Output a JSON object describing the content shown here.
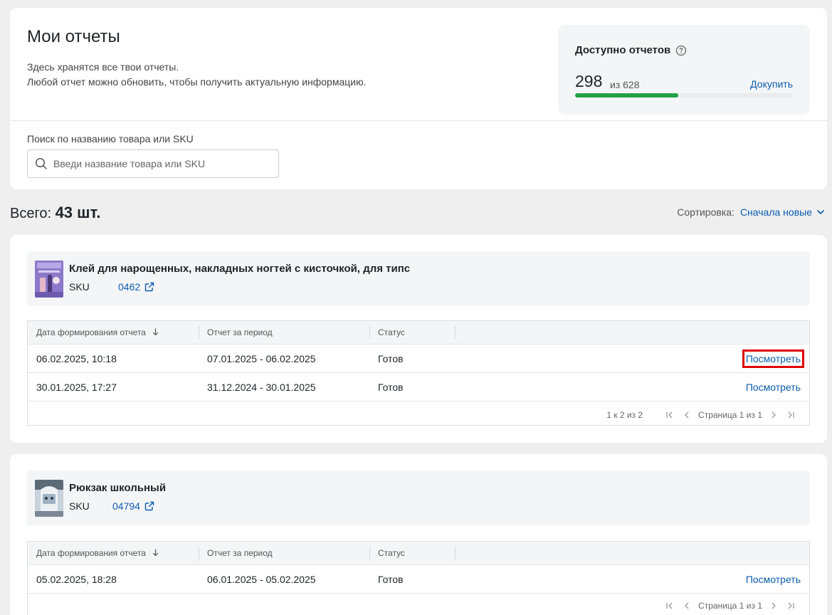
{
  "header": {
    "title": "Мои отчеты",
    "desc_line1": "Здесь хранятся все твои отчеты.",
    "desc_line2": "Любой отчет можно обновить, чтобы получить актуальную информацию.",
    "search_label": "Поиск по названию товара или SKU",
    "search_placeholder": "Введи название товара или SKU",
    "search_value": ""
  },
  "available": {
    "title": "Доступно отчетов",
    "count": "298",
    "of_total": "из 628",
    "buy_label": "Докупить",
    "used_fraction": 0.474
  },
  "summary": {
    "total_label": "Всего:",
    "total_value": "43 шт.",
    "sort_label": "Сортировка:",
    "sort_value": "Сначала новые"
  },
  "table_headers": {
    "date": "Дата формирования отчета",
    "period": "Отчет за период",
    "status": "Статус"
  },
  "products": [
    {
      "name": "Клей для нарощенных, накладных ногтей с кисточкой, для типс",
      "sku_label": "SKU",
      "sku": "0462",
      "reports": [
        {
          "date": "06.02.2025, 10:18",
          "period": "07.01.2025 - 06.02.2025",
          "status": "Готов",
          "action": "Посмотреть"
        },
        {
          "date": "30.01.2025, 17:27",
          "period": "31.12.2024 - 30.01.2025",
          "status": "Готов",
          "action": "Посмотреть"
        }
      ],
      "pager": {
        "range": "1 к 2 из 2",
        "page": "Страница 1 из 1"
      }
    },
    {
      "name": "Рюкзак школьный",
      "sku_label": "SKU",
      "sku": "04794",
      "reports": [
        {
          "date": "05.02.2025, 18:28",
          "period": "06.01.2025 - 05.02.2025",
          "status": "Готов",
          "action": "Посмотреть"
        }
      ],
      "pager": {
        "range": "",
        "page": "Страница 1 из 1"
      }
    }
  ],
  "colors": {
    "accent": "#0b5cad",
    "progress": "#22a146",
    "highlight": "#e00000"
  }
}
